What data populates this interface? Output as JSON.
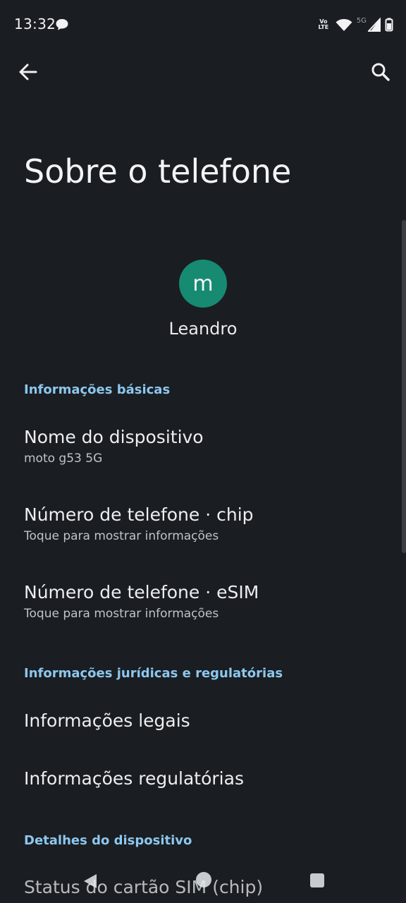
{
  "status_bar": {
    "time": "13:32",
    "volte_top": "Vo",
    "volte_bottom": "LTE",
    "network_label": "5G"
  },
  "toolbar": {
    "back_icon": "arrow-left-icon",
    "search_icon": "search-icon"
  },
  "page": {
    "title": "Sobre o telefone"
  },
  "profile": {
    "avatar_letter": "m",
    "avatar_color": "#178a72",
    "name": "Leandro"
  },
  "sections": {
    "basic": {
      "header": "Informações básicas",
      "items": [
        {
          "title": "Nome do dispositivo",
          "subtitle": "moto g53 5G"
        },
        {
          "title": "Número de telefone · chip",
          "subtitle": "Toque para mostrar informações"
        },
        {
          "title": "Número de telefone · eSIM",
          "subtitle": "Toque para mostrar informações"
        }
      ]
    },
    "legal": {
      "header": "Informações jurídicas e regulatórias",
      "items": [
        {
          "title": "Informações legais"
        },
        {
          "title": "Informações regulatórias"
        }
      ]
    },
    "device": {
      "header": "Detalhes do dispositivo",
      "items": [
        {
          "title": "Status do cartão SIM (chip)"
        }
      ]
    }
  },
  "colors": {
    "background": "#1a1d21",
    "accent": "#8cc7ee"
  }
}
